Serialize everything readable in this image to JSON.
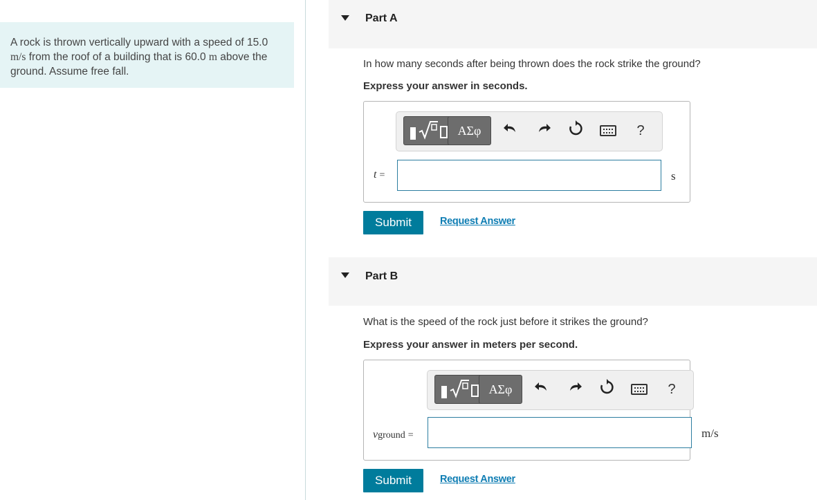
{
  "problem": {
    "text_parts": [
      "A rock is thrown vertically upward with a speed of ",
      "15.0 ",
      "m/s",
      " from the roof of a building that is 60.0 ",
      "m",
      " above the ground. Assume free fall."
    ]
  },
  "parts": [
    {
      "title": "Part A",
      "question": "In how many seconds after being thrown does the rock strike the ground?",
      "instruction": "Express your answer in seconds.",
      "variable": "t",
      "equals": "=",
      "unit": "s",
      "input_value": "",
      "toolbar": {
        "greek_label": "ΑΣφ",
        "help_label": "?"
      },
      "submit_label": "Submit",
      "request_label": "Request Answer"
    },
    {
      "title": "Part B",
      "question": "What is the speed of the rock just before it strikes the ground?",
      "instruction": "Express your answer in meters per second.",
      "variable": "v",
      "variable_sub": "ground",
      "equals": "=",
      "unit": "m/s",
      "input_value": "",
      "toolbar": {
        "greek_label": "ΑΣφ",
        "help_label": "?"
      },
      "submit_label": "Submit",
      "request_label": "Request Answer"
    }
  ],
  "icons": [
    "templates-icon",
    "greek-symbols-icon",
    "undo-icon",
    "redo-icon",
    "reset-icon",
    "keyboard-icon",
    "help-icon",
    "collapse-triangle-icon"
  ],
  "colors": {
    "accent": "#007c9c",
    "link": "#0e7db3",
    "problem_bg": "#e5f4f5",
    "part_header_bg": "#f5f5f5",
    "toolbar_btn": "#6d6d6d"
  }
}
